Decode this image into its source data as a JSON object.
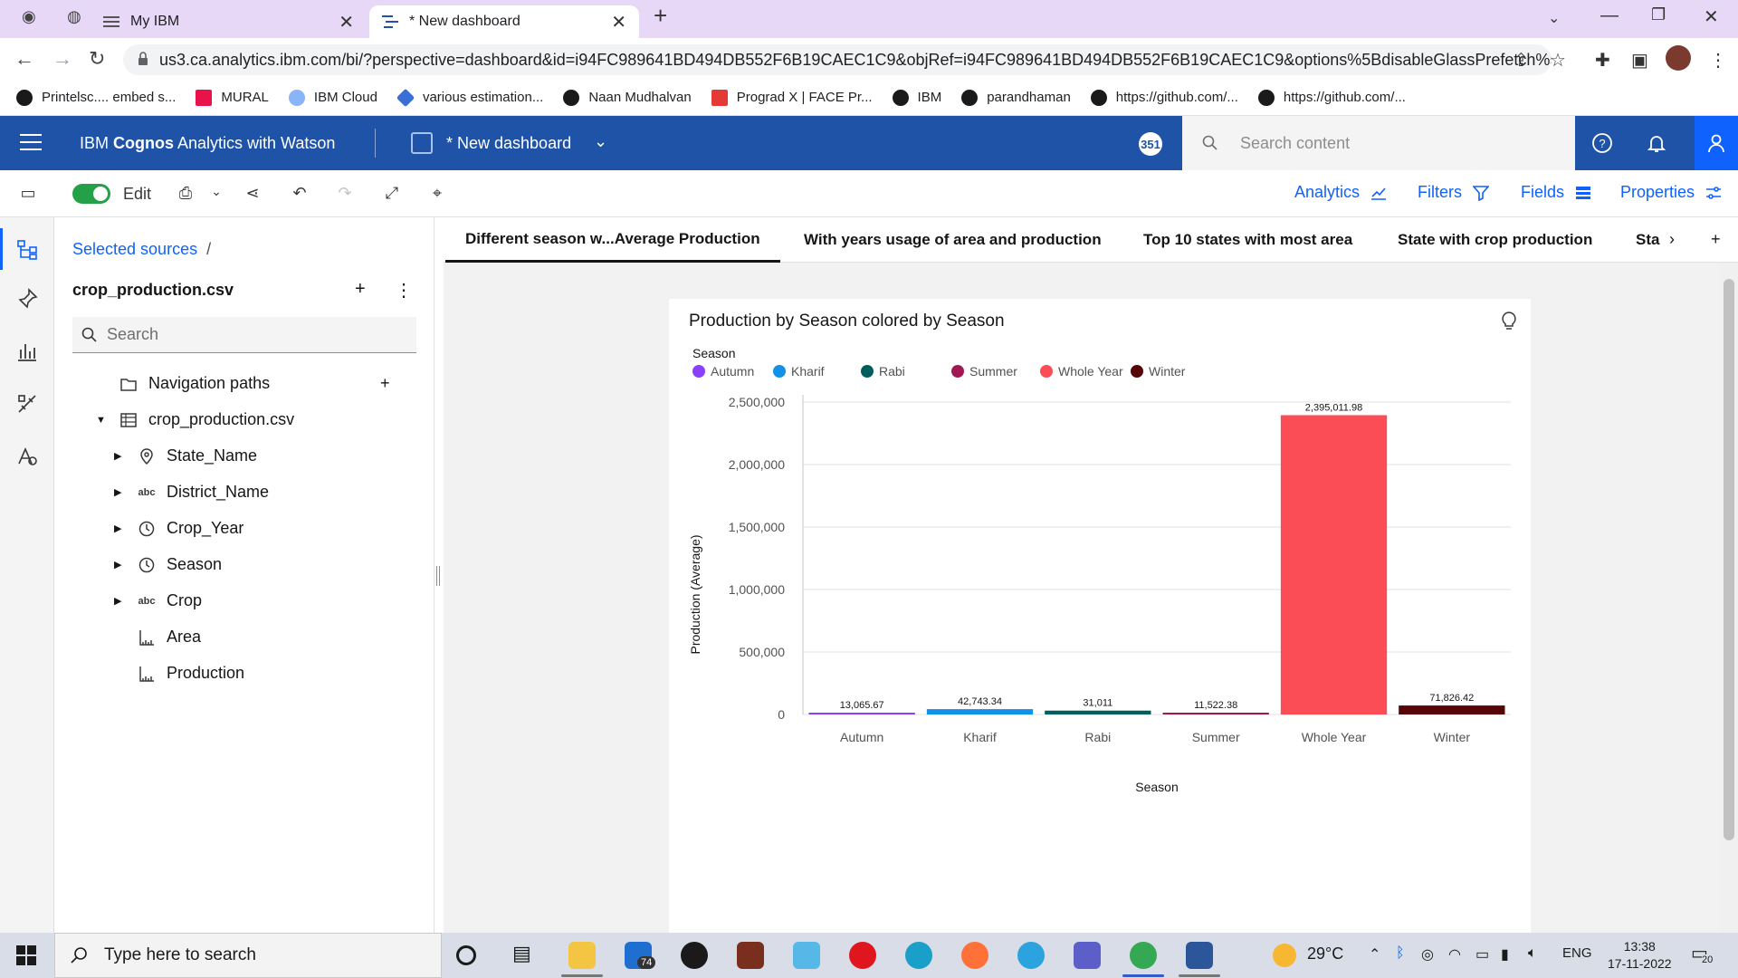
{
  "browser": {
    "tabs": [
      {
        "label": "My IBM"
      },
      {
        "label": "* New dashboard"
      }
    ],
    "url": "us3.ca.analytics.ibm.com/bi/?perspective=dashboard&id=i94FC989641BD494DB552F6B19CAEC1C9&objRef=i94FC989641BD494DB552F6B19CAEC1C9&options%5BdisableGlassPrefetch%5D...",
    "bookmarks": [
      {
        "label": "Printelsc.... embed s...",
        "color": "#1a1a1a"
      },
      {
        "label": "MURAL",
        "color": "#e8134a"
      },
      {
        "label": "IBM Cloud",
        "color": "#8ab4f8"
      },
      {
        "label": "various estimation...",
        "color": "#3a6fd8"
      },
      {
        "label": "Naan Mudhalvan",
        "color": "#1a1a1a"
      },
      {
        "label": "Prograd X | FACE Pr...",
        "color": "#e53935"
      },
      {
        "label": "IBM",
        "color": "#1a1a1a"
      },
      {
        "label": "parandhaman",
        "color": "#1a1a1a"
      },
      {
        "label": "https://github.com/...",
        "color": "#1a1a1a"
      },
      {
        "label": "https://github.com/...",
        "color": "#1a1a1a"
      }
    ]
  },
  "header": {
    "brand_prefix": "IBM ",
    "brand_bold": "Cognos",
    "brand_suffix": " Analytics with Watson",
    "dashboard_title": "* New dashboard",
    "badge": "351",
    "search_placeholder": "Search content"
  },
  "toolbar": {
    "edit_label": "Edit",
    "analytics": "Analytics",
    "filters": "Filters",
    "fields": "Fields",
    "properties": "Properties"
  },
  "sources": {
    "crumb": "Selected sources",
    "crumb_sep": "/",
    "name": "crop_production.csv",
    "search_placeholder": "Search",
    "nav_paths": "Navigation paths",
    "table": "crop_production.csv",
    "fields": [
      {
        "label": "State_Name",
        "icon": "location-icon",
        "expandable": true
      },
      {
        "label": "District_Name",
        "icon": "abc-icon",
        "expandable": true
      },
      {
        "label": "Crop_Year",
        "icon": "clock-icon",
        "expandable": true
      },
      {
        "label": "Season",
        "icon": "clock-icon",
        "expandable": true
      },
      {
        "label": "Crop",
        "icon": "abc-icon",
        "expandable": true
      },
      {
        "label": "Area",
        "icon": "measure-icon",
        "expandable": false
      },
      {
        "label": "Production",
        "icon": "measure-icon",
        "expandable": false
      }
    ]
  },
  "view_tabs": [
    {
      "label": "Different season w...Average Production",
      "active": true
    },
    {
      "label": "With years usage of area and production",
      "active": false
    },
    {
      "label": "Top 10 states with most area",
      "active": false
    },
    {
      "label": "State with crop production",
      "active": false
    },
    {
      "label": "Sta",
      "active": false
    }
  ],
  "chart_card": {
    "title": "Production by Season colored by Season",
    "legend_title": "Season"
  },
  "chart_data": {
    "type": "bar",
    "title": "Production by Season colored by Season",
    "xlabel": "Season",
    "ylabel": "Production (Average)",
    "categories": [
      "Autumn",
      "Kharif",
      "Rabi",
      "Summer",
      "Whole Year",
      "Winter"
    ],
    "values": [
      13065.67,
      42743.34,
      31011,
      11522.38,
      2395011.98,
      71826.42
    ],
    "value_labels": [
      "13,065.67",
      "42,743.34",
      "31,011",
      "11,522.38",
      "2,395,011.98",
      "71,826.42"
    ],
    "colors": [
      "#8a3ffc",
      "#1192e8",
      "#005d5d",
      "#9f1853",
      "#fa4d56",
      "#570408"
    ],
    "ylim": [
      0,
      2500000
    ],
    "yticks": [
      0,
      500000,
      1000000,
      1500000,
      2000000,
      2500000
    ],
    "ytick_labels": [
      "0",
      "500,000",
      "1,000,000",
      "1,500,000",
      "2,000,000",
      "2,500,000"
    ],
    "grid": true,
    "legend": "top-left"
  },
  "taskbar": {
    "search_placeholder": "Type here to search",
    "weather": "29°C",
    "lang": "ENG",
    "time": "13:38",
    "date": "17-11-2022",
    "mail_badge": "74",
    "notif_badge": "20"
  }
}
